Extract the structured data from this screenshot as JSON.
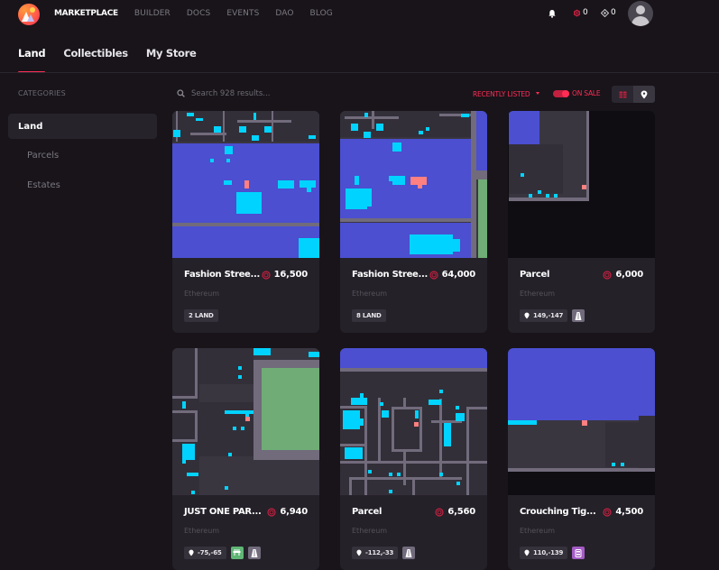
{
  "header": {
    "nav": [
      {
        "label": "MARKETPLACE",
        "active": true
      },
      {
        "label": "BUILDER",
        "active": false
      },
      {
        "label": "DOCS",
        "active": false
      },
      {
        "label": "EVENTS",
        "active": false
      },
      {
        "label": "DAO",
        "active": false
      },
      {
        "label": "BLOG",
        "active": false
      }
    ],
    "mana_balance": "0",
    "eth_balance": "0",
    "icons": {
      "notifications": "bell-icon",
      "mana": "mana-icon",
      "eth": "ethereum-icon",
      "avatar": "user-avatar-icon"
    }
  },
  "tabs": [
    {
      "label": "Land",
      "active": true
    },
    {
      "label": "Collectibles",
      "active": false
    },
    {
      "label": "My Store",
      "active": false
    }
  ],
  "sidebar": {
    "title": "CATEGORIES",
    "items": [
      {
        "label": "Land",
        "active": true
      },
      {
        "label": "Parcels",
        "active": false
      },
      {
        "label": "Estates",
        "active": false
      }
    ]
  },
  "toolbar": {
    "search_placeholder": "Search 928 results...",
    "sort_label": "RECENTLY LISTED",
    "on_sale_label": "ON SALE",
    "on_sale_enabled": true,
    "view_mode": "map"
  },
  "colors": {
    "accent": "#ff2d55",
    "background": "#18141a",
    "card": "#242129",
    "district": "#4b4fd0",
    "owned": "#00d3ff",
    "plaza": "#70ac76",
    "road": "#716b7c",
    "selected": "#ff8080"
  },
  "cards": [
    {
      "title": "Fashion Stree...",
      "price": "16,500",
      "network": "Ethereum",
      "tags": [
        {
          "type": "size",
          "label": "2 LAND"
        }
      ]
    },
    {
      "title": "Fashion Stree...",
      "price": "64,000",
      "network": "Ethereum",
      "tags": [
        {
          "type": "size",
          "label": "8 LAND"
        }
      ]
    },
    {
      "title": "Parcel",
      "price": "6,000",
      "network": "Ethereum",
      "tags": [
        {
          "type": "coords",
          "label": "149,-147"
        },
        {
          "type": "road",
          "label": ""
        }
      ]
    },
    {
      "title": "JUST ONE PAR...",
      "price": "6,940",
      "network": "Ethereum",
      "tags": [
        {
          "type": "coords",
          "label": "-75,-65"
        },
        {
          "type": "plaza",
          "label": ""
        },
        {
          "type": "road",
          "label": ""
        }
      ]
    },
    {
      "title": "Parcel",
      "price": "6,560",
      "network": "Ethereum",
      "tags": [
        {
          "type": "coords",
          "label": "-112,-33"
        },
        {
          "type": "road",
          "label": ""
        }
      ]
    },
    {
      "title": "Crouching Tig...",
      "price": "4,500",
      "network": "Ethereum",
      "tags": [
        {
          "type": "coords",
          "label": "110,-139"
        },
        {
          "type": "district",
          "label": ""
        }
      ]
    }
  ]
}
